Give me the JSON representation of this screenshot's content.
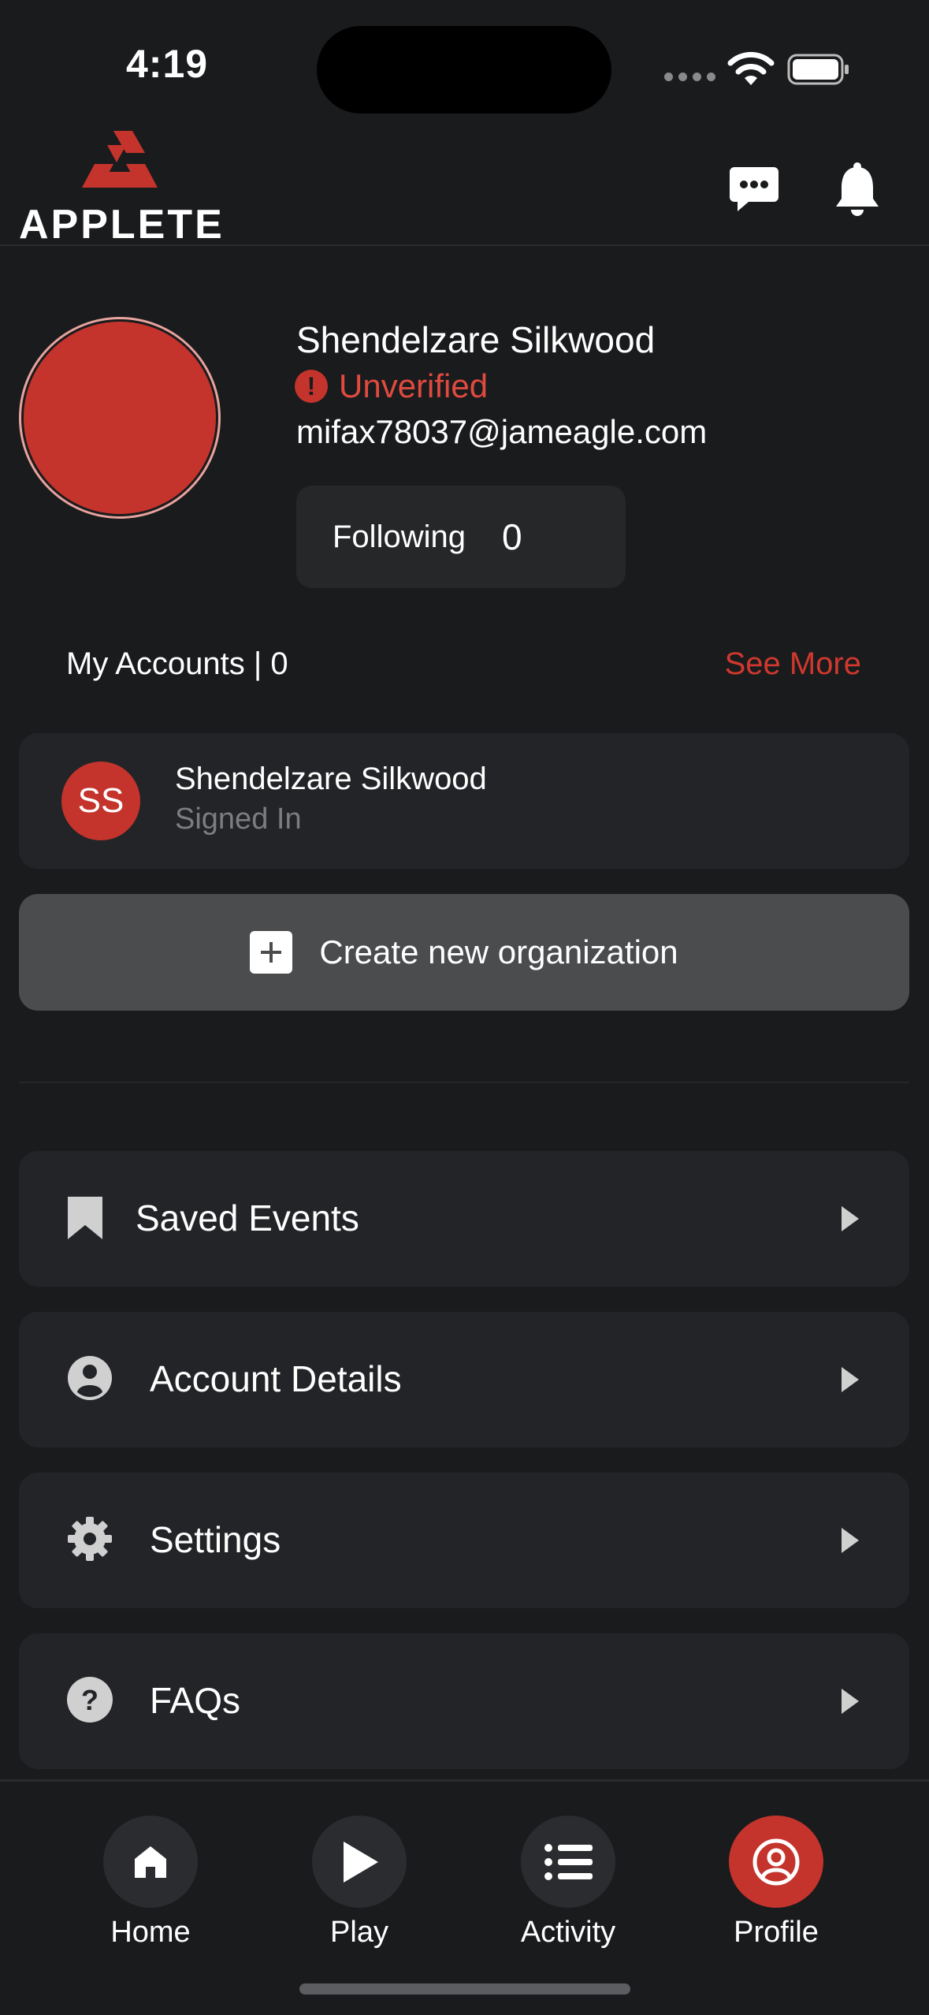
{
  "status_bar": {
    "time": "4:19"
  },
  "header": {
    "logo_text": "APPLETE",
    "chat_icon": "chat-bubble-icon",
    "bell_icon": "bell-icon"
  },
  "profile": {
    "name": "Shendelzare Silkwood",
    "verification": "Unverified",
    "email": "mifax78037@jameagle.com",
    "following_label": "Following",
    "following_count": "0"
  },
  "accounts": {
    "title": "My Accounts | 0",
    "see_more": "See More",
    "items": [
      {
        "initials": "SS",
        "name": "Shendelzare Silkwood",
        "status": "Signed In"
      }
    ],
    "create_label": "Create new organization"
  },
  "menu": [
    {
      "label": "Saved Events",
      "icon": "bookmark-icon"
    },
    {
      "label": "Account Details",
      "icon": "user-circle-icon"
    },
    {
      "label": "Settings",
      "icon": "gear-icon"
    },
    {
      "label": "FAQs",
      "icon": "question-icon"
    }
  ],
  "nav": [
    {
      "label": "Home",
      "icon": "home-icon"
    },
    {
      "label": "Play",
      "icon": "play-icon"
    },
    {
      "label": "Activity",
      "icon": "list-icon"
    },
    {
      "label": "Profile",
      "icon": "profile-icon",
      "active": true
    }
  ],
  "colors": {
    "accent": "#c4342c",
    "background": "#1a1b1d",
    "card": "#232427"
  }
}
